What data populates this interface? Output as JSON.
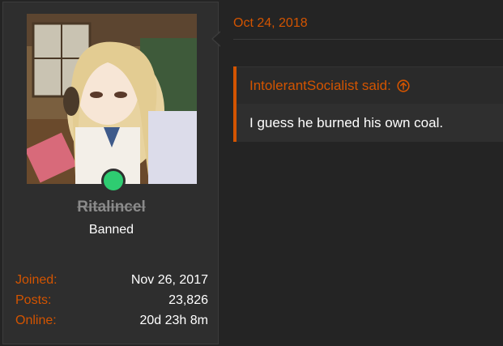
{
  "post": {
    "date": "Oct 24, 2018"
  },
  "user": {
    "name": "Ritalincel",
    "title": "Banned",
    "avatar_icon": "anime-avatar",
    "online_status_color": "#2ecc71",
    "stats": [
      {
        "label": "Joined:",
        "value": "Nov 26, 2017"
      },
      {
        "label": "Posts:",
        "value": "23,826"
      },
      {
        "label": "Online:",
        "value": "20d 23h 8m"
      }
    ]
  },
  "quote": {
    "author_said": "IntolerantSocialist said:",
    "icon": "arrow-up-circle-icon",
    "text": "I guess he burned his own coal."
  },
  "colors": {
    "accent": "#d35400",
    "background": "#242424",
    "panel": "#2e2e2e"
  }
}
